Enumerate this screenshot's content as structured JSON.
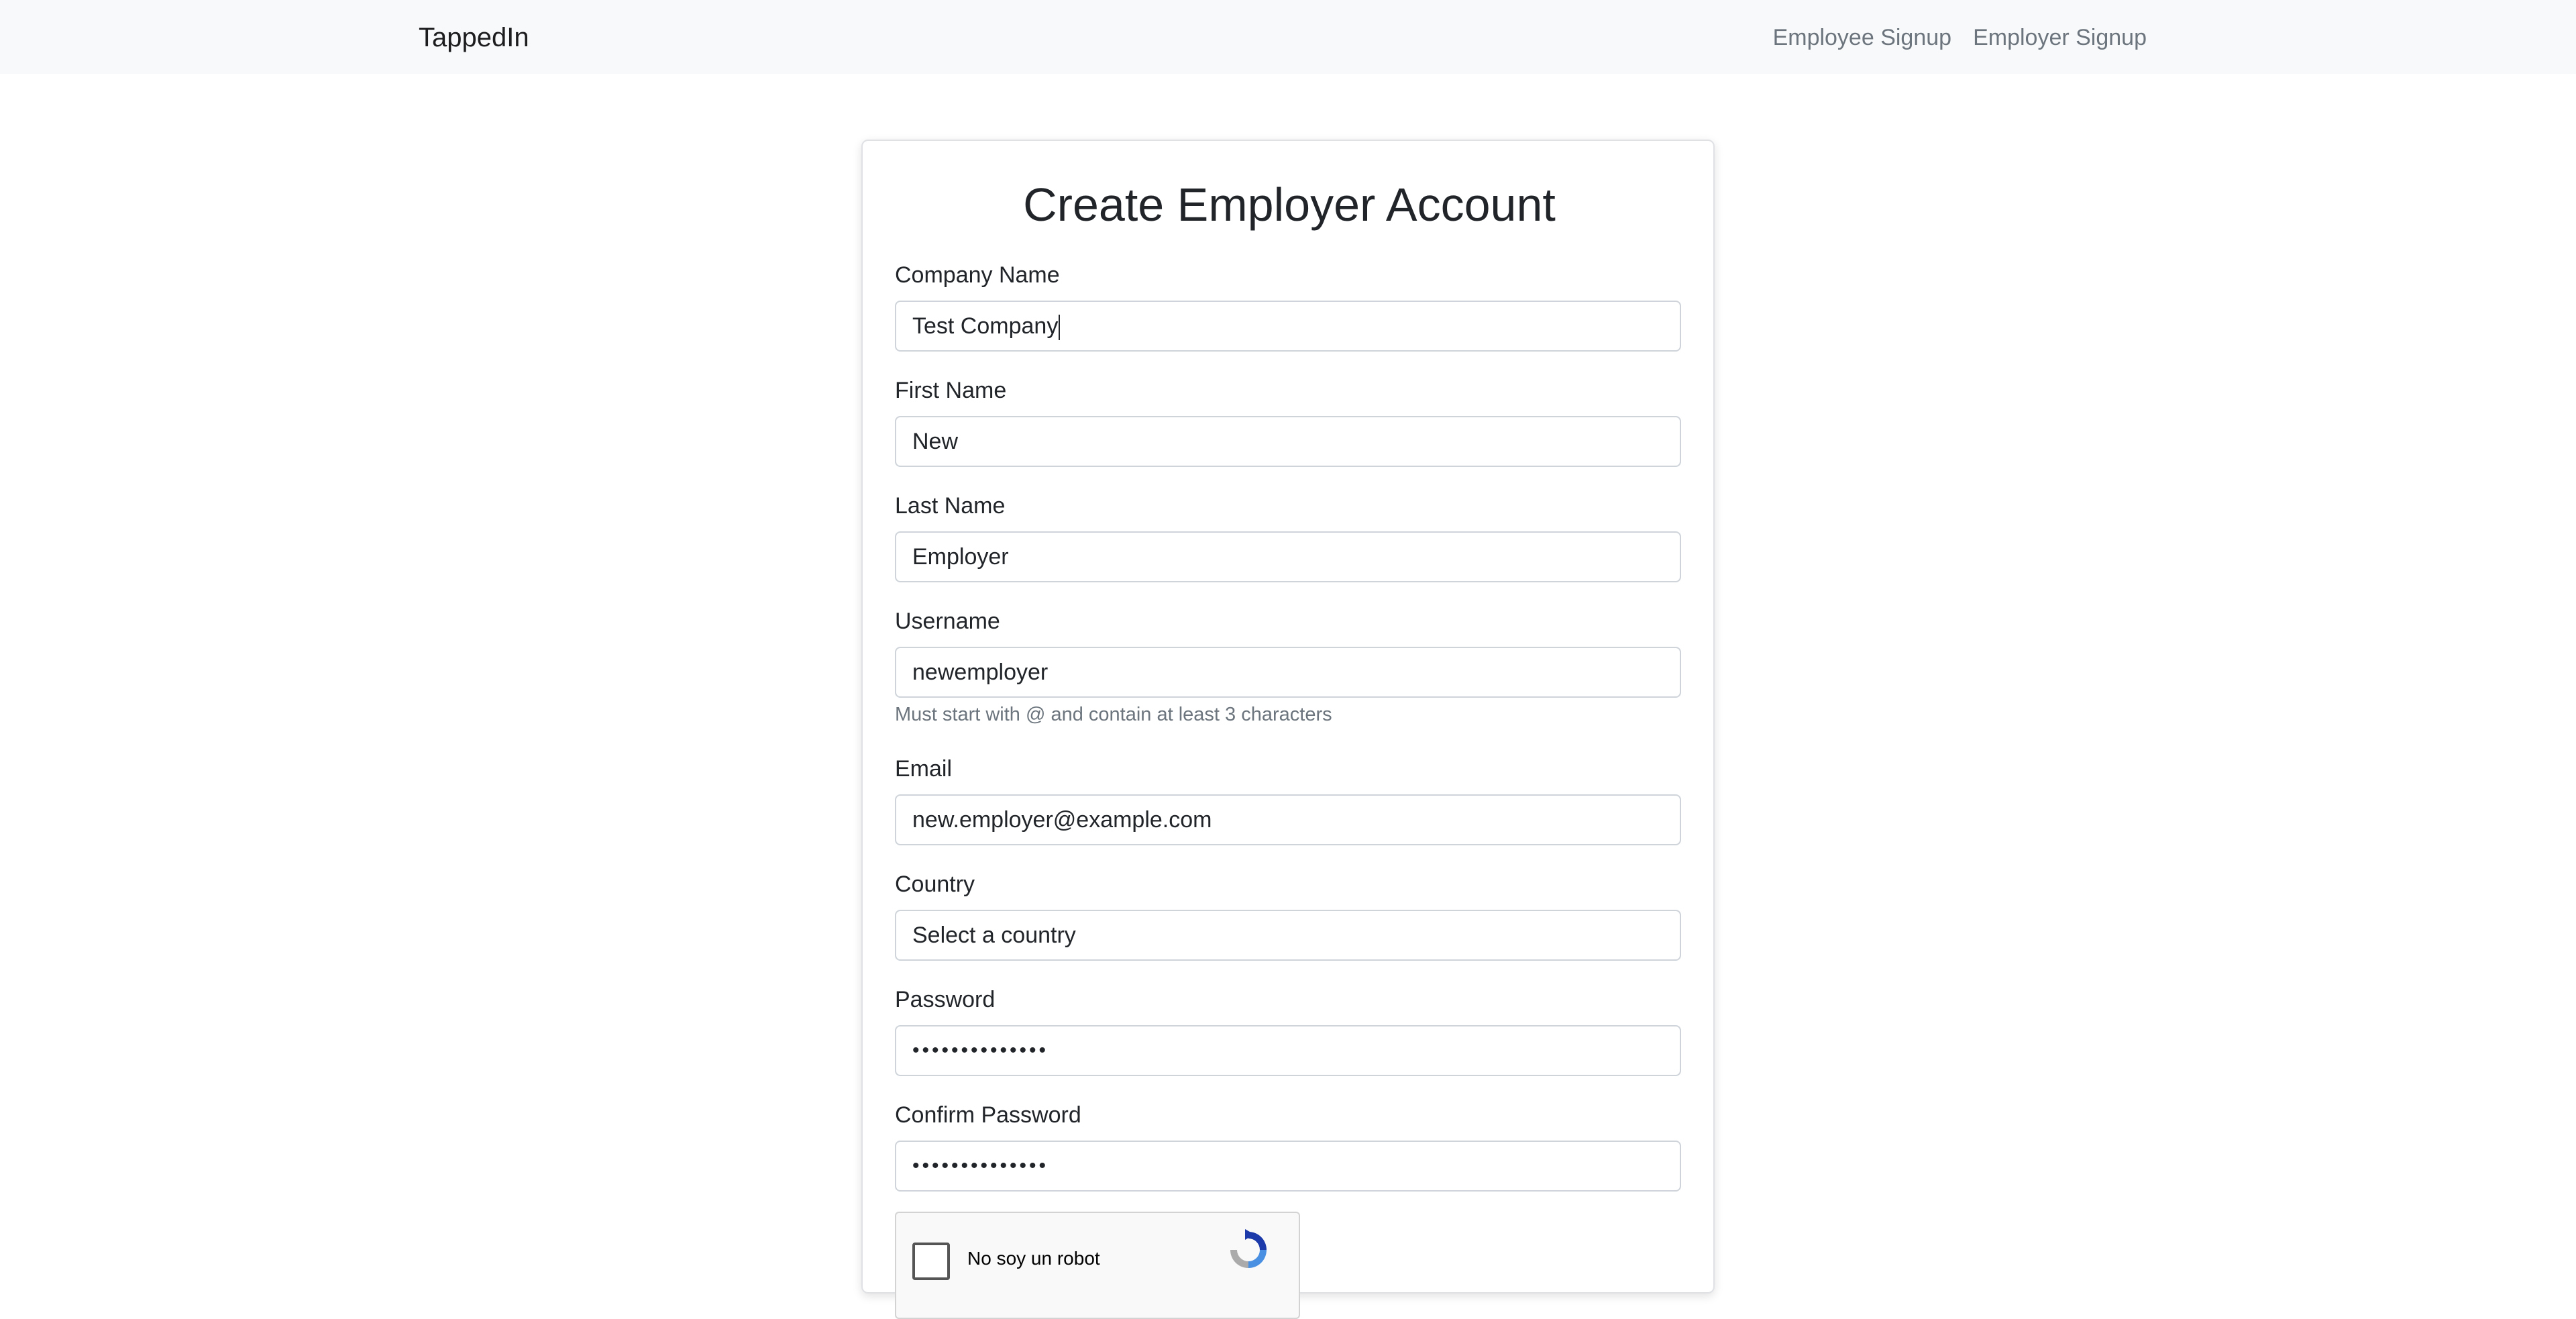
{
  "navbar": {
    "brand": "TappedIn",
    "links": [
      "Employee Signup",
      "Employer Signup"
    ]
  },
  "form": {
    "title": "Create Employer Account",
    "company_name": {
      "label": "Company Name",
      "value": "Test Company"
    },
    "first_name": {
      "label": "First Name",
      "value": "New"
    },
    "last_name": {
      "label": "Last Name",
      "value": "Employer"
    },
    "username": {
      "label": "Username",
      "value": "newemployer",
      "help": "Must start with @ and contain at least 3 characters"
    },
    "email": {
      "label": "Email",
      "value": "new.employer@example.com"
    },
    "country": {
      "label": "Country",
      "value": "Select a country"
    },
    "password": {
      "label": "Password",
      "value": "••••••••••••••"
    },
    "confirm_password": {
      "label": "Confirm Password",
      "value": "••••••••••••••"
    }
  },
  "captcha": {
    "label": "No soy un robot"
  },
  "colors": {
    "navbar_bg": "#f8f9fa",
    "muted_text": "#6c757d",
    "input_border": "#ced4da"
  }
}
